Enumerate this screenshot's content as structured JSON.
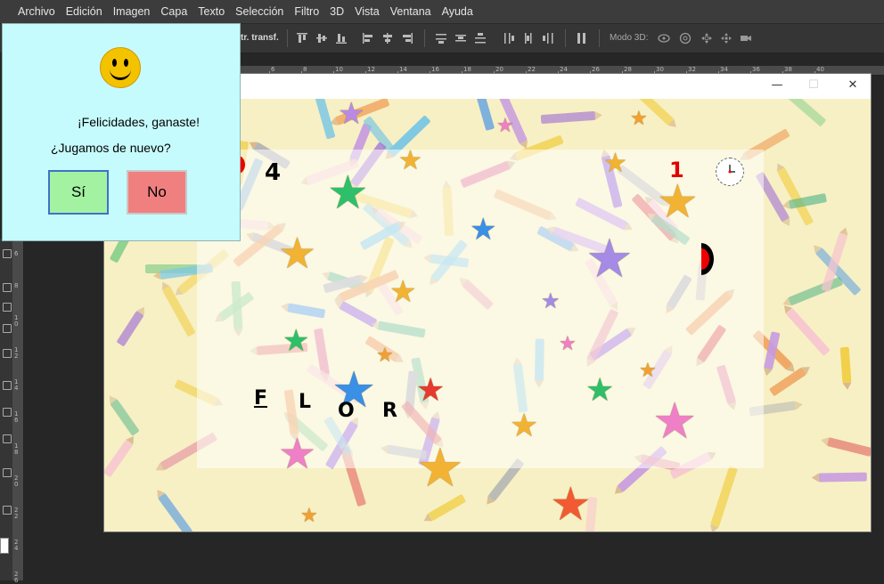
{
  "menu": {
    "items": [
      "Archivo",
      "Edición",
      "Imagen",
      "Capa",
      "Texto",
      "Selección",
      "Filtro",
      "3D",
      "Vista",
      "Ventana",
      "Ayuda"
    ]
  },
  "options_bar": {
    "transform_label": "tr. transf.",
    "mode3d_label": "Modo 3D:"
  },
  "rulers": {
    "top_ticks": [
      "6",
      "8",
      "10",
      "12",
      "14",
      "16",
      "18",
      "20",
      "22",
      "24",
      "26",
      "28",
      "30",
      "32",
      "34",
      "36",
      "38",
      "40"
    ],
    "left_ticks": [
      "6",
      "8",
      "1 0",
      "1 2",
      "1 4",
      "1 6",
      "1 8",
      "2 0",
      "2 2",
      "2 4",
      "2 6"
    ]
  },
  "game": {
    "score": "4",
    "lives": "1",
    "letters": [
      "F",
      "L",
      "O",
      "R"
    ]
  },
  "dialog": {
    "message": "¡Felicidades, ganaste!",
    "question": "¿Jugamos de nuevo?",
    "yes_label": "Sí",
    "no_label": "No"
  },
  "colors": {
    "dialog_bg": "#c6fbfd",
    "yes_bg": "#a2f2a2",
    "no_bg": "#f08080",
    "smiley": "#f4c300"
  }
}
